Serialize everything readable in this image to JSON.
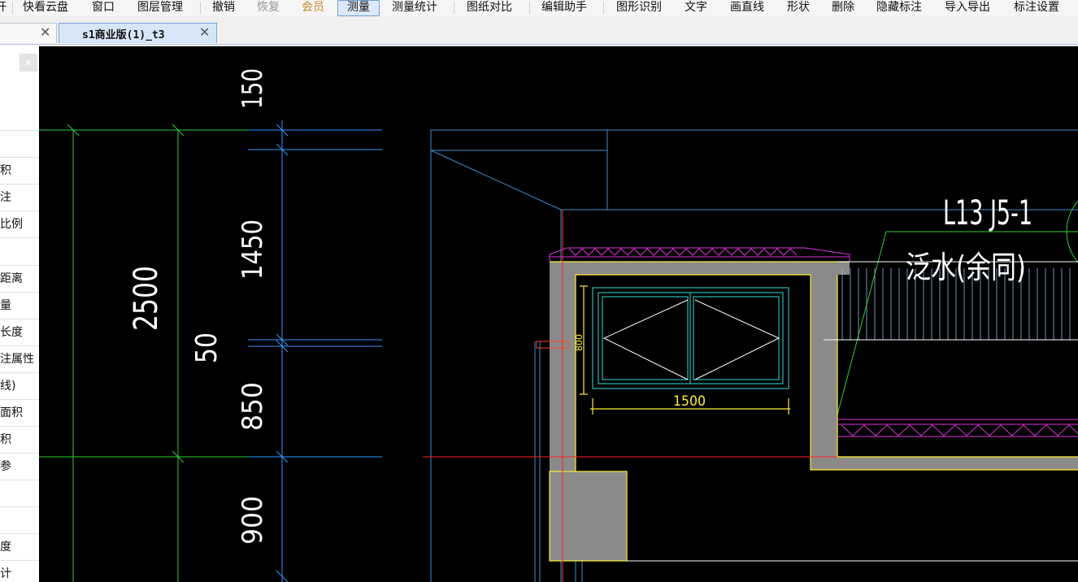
{
  "menubar": {
    "items": [
      "开",
      "快看云盘",
      "窗口",
      "图层管理",
      "撤销",
      "恢复",
      "会员",
      "测量",
      "测量统计",
      "图纸对比",
      "编辑助手",
      "图形识别",
      "文字",
      "画直线",
      "形状",
      "删除",
      "隐藏标注",
      "导入导出",
      "标注设置"
    ]
  },
  "tabs": [
    {
      "label": "",
      "close": "✕"
    },
    {
      "label": "s1商业版(1)_t3",
      "close": "✕"
    }
  ],
  "panel": {
    "close": "✕",
    "rows": [
      "积",
      "注",
      "比例",
      "距离",
      "量",
      "长度",
      "注属性",
      "线)",
      "面积",
      "积",
      "参",
      "度",
      "计"
    ]
  },
  "drawing": {
    "dimensions": [
      "150",
      "1450",
      "2500",
      "50",
      "850",
      "900",
      "800",
      "1500"
    ],
    "annotations": [
      "L13 J5-1",
      "泛水(余同)"
    ]
  },
  "colors": {
    "canvas": "#000000",
    "active_tool": "#dde9f8",
    "member": "#c88a2b"
  }
}
